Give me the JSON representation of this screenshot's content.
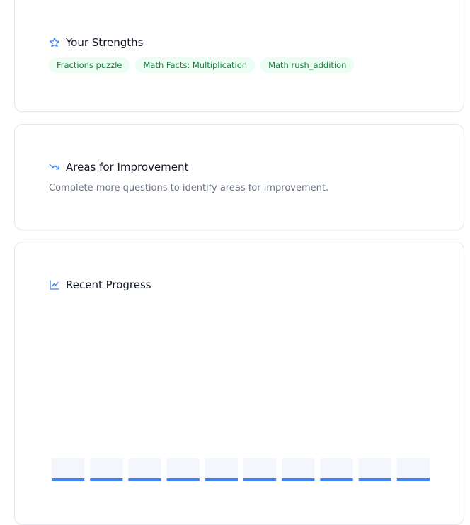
{
  "colors": {
    "accent": "#3b82f6",
    "chip_bg": "#ecfdf3",
    "chip_text": "#15803d",
    "muted_text": "#6b7280",
    "bar_track": "#f3f7fd"
  },
  "strengths": {
    "title": "Your Strengths",
    "icon": "star-icon",
    "chips": [
      "Fractions puzzle",
      "Math Facts: Multiplication",
      "Math rush_addition"
    ]
  },
  "improvement": {
    "title": "Areas for Improvement",
    "icon": "trending-down-icon",
    "message": "Complete more questions to identify areas for improvement."
  },
  "progress": {
    "title": "Recent Progress",
    "icon": "line-chart-icon"
  },
  "chart_data": {
    "type": "bar",
    "title": "",
    "xlabel": "",
    "ylabel": "",
    "categories": [
      "",
      "",
      "",
      "",
      "",
      "",
      "",
      "",
      "",
      ""
    ],
    "values": [
      0,
      0,
      0,
      0,
      0,
      0,
      0,
      0,
      0,
      0
    ],
    "ylim": [
      0,
      100
    ],
    "grid": false,
    "legend": "none"
  }
}
